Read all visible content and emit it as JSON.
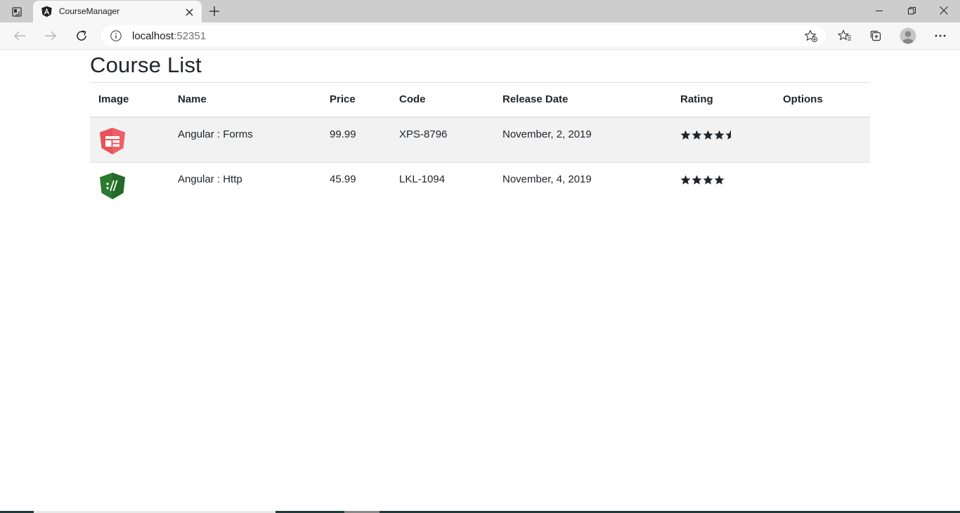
{
  "browser": {
    "tab": {
      "title": "CourseManager",
      "favicon": "angular-logo-icon"
    },
    "address": {
      "host": "localhost",
      "port": ":52351"
    }
  },
  "page": {
    "title": "Course List",
    "table": {
      "columns": [
        "Image",
        "Name",
        "Price",
        "Code",
        "Release Date",
        "Rating",
        "Options"
      ],
      "rows": [
        {
          "image": "angular-forms-logo",
          "image_color": "#e9525a",
          "name": "Angular : Forms",
          "price": "99.99",
          "code": "XPS-8796",
          "release_date": "November, 2, 2019",
          "rating": 4.5,
          "options": ""
        },
        {
          "image": "angular-http-logo",
          "image_color": "#2b7a2f",
          "name": "Angular : Http",
          "price": "45.99",
          "code": "LKL-1094",
          "release_date": "November, 4, 2019",
          "rating": 4,
          "options": ""
        }
      ]
    }
  },
  "colors": {
    "row_stripe": "#f2f2f2",
    "border": "#dee2e6",
    "text": "#212529",
    "star": "#212529"
  }
}
